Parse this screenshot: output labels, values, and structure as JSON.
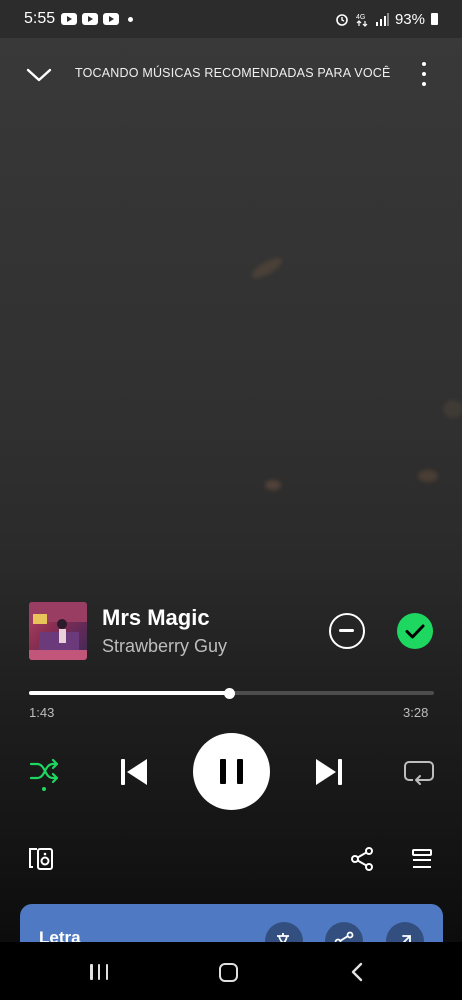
{
  "status_bar": {
    "time": "5:55",
    "battery": "93%"
  },
  "header": {
    "title": "TOCANDO MÚSICAS RECOMENDADAS PARA VOCÊ"
  },
  "track": {
    "title": "Mrs Magic",
    "artist": "Strawberry Guy"
  },
  "progress": {
    "elapsed": "1:43",
    "total": "3:28",
    "fraction": 0.495
  },
  "controls": {
    "shuffle_active": true,
    "state": "playing"
  },
  "lyrics": {
    "label": "Letra"
  },
  "colors": {
    "accent": "#1ed760",
    "lyrics_card": "#4f7ac3"
  }
}
